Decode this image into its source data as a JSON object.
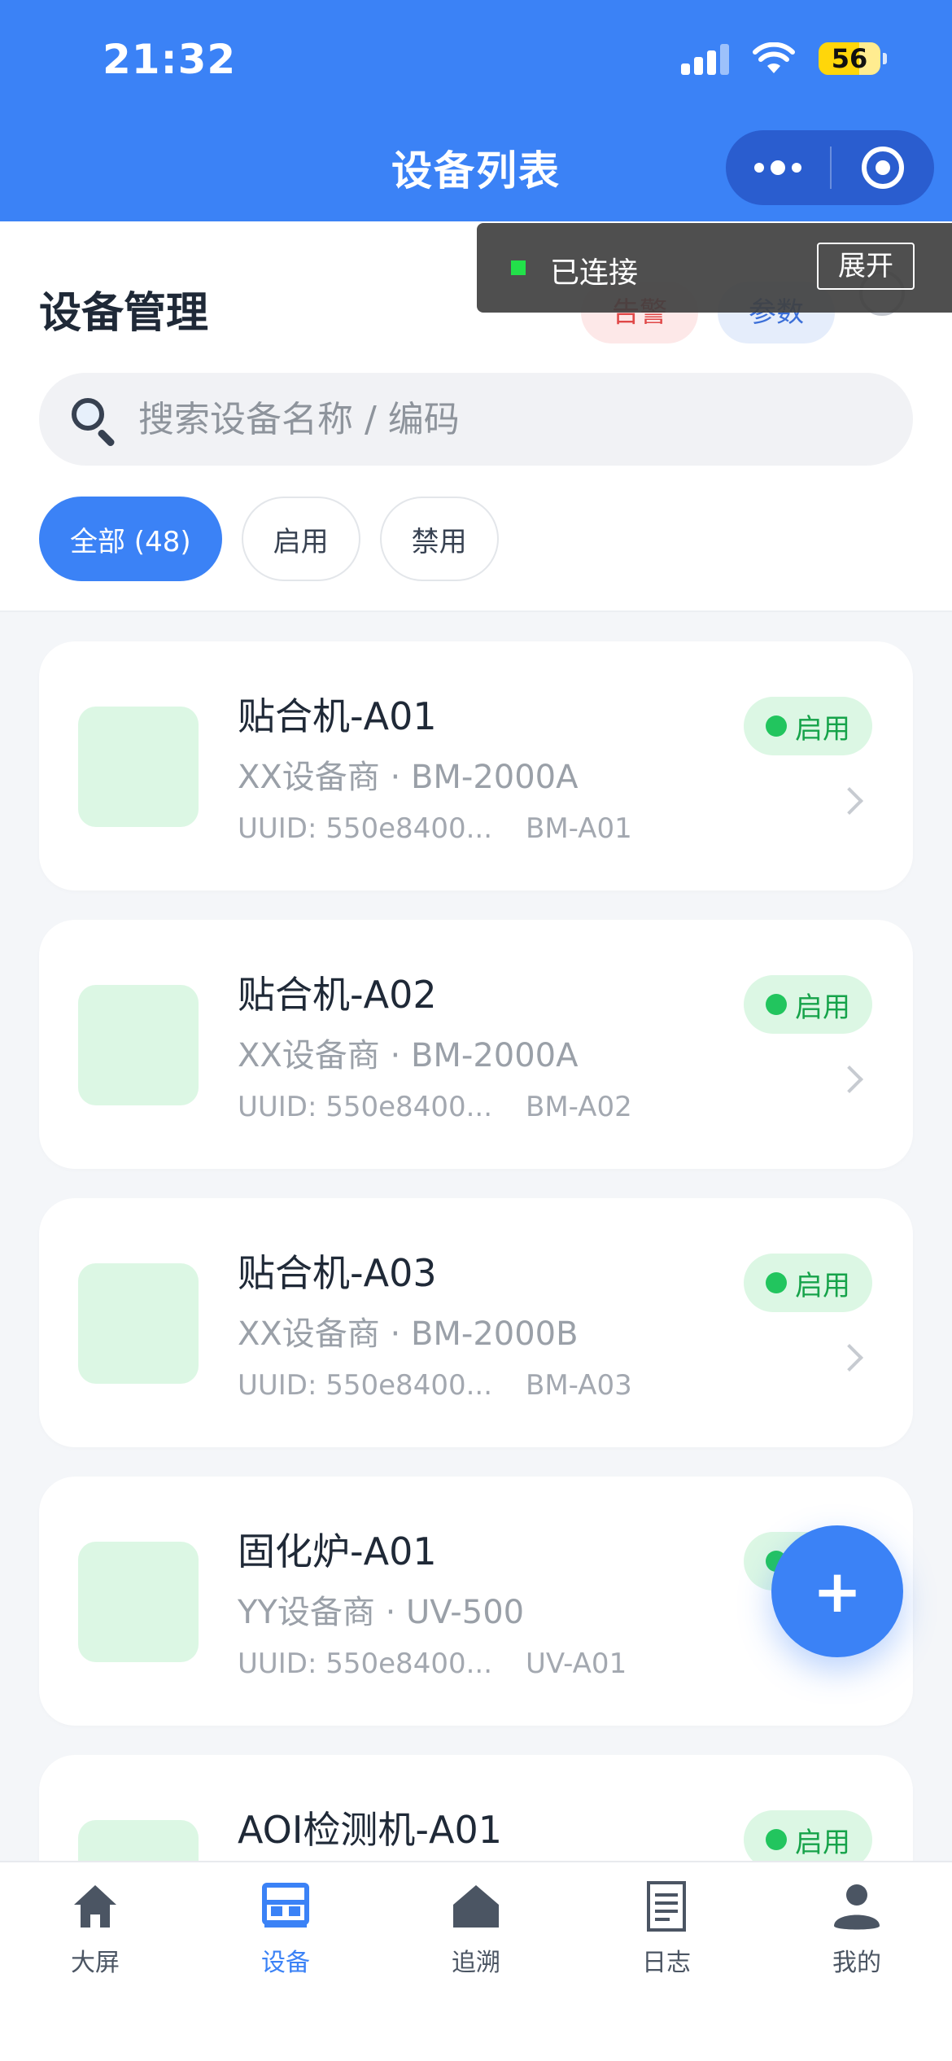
{
  "status_bar": {
    "time": "21:32",
    "battery": "56"
  },
  "nav": {
    "title": "设备列表"
  },
  "header": {
    "title": "设备管理",
    "alarm_label": "告警",
    "param_label": "参数"
  },
  "search": {
    "placeholder": "搜索设备名称 / 编码"
  },
  "filters": [
    {
      "label": "全部 (48)",
      "active": true
    },
    {
      "label": "启用",
      "active": false
    },
    {
      "label": "禁用",
      "active": false
    }
  ],
  "toast": {
    "text": "已连接",
    "button": "展开"
  },
  "devices": [
    {
      "name": "贴合机-A01",
      "vendor": "XX设备商 · BM-2000A",
      "uuid": "UUID: 550e8400...",
      "code": "BM-A01",
      "status": "启用"
    },
    {
      "name": "贴合机-A02",
      "vendor": "XX设备商 · BM-2000A",
      "uuid": "UUID: 550e8400...",
      "code": "BM-A02",
      "status": "启用"
    },
    {
      "name": "贴合机-A03",
      "vendor": "XX设备商 · BM-2000B",
      "uuid": "UUID: 550e8400...",
      "code": "BM-A03",
      "status": "启用"
    },
    {
      "name": "固化炉-A01",
      "vendor": "YY设备商 · UV-500",
      "uuid": "UUID: 550e8400...",
      "code": "UV-A01",
      "status": "启用"
    },
    {
      "name": "AOI检测机-A01",
      "vendor": "",
      "uuid": "",
      "code": "",
      "status": "启用"
    }
  ],
  "fab": {
    "label": "+"
  },
  "tabbar": [
    {
      "label": "大屏",
      "icon": "home-icon",
      "active": false
    },
    {
      "label": "设备",
      "icon": "device-icon",
      "active": true
    },
    {
      "label": "追溯",
      "icon": "trace-icon",
      "active": false
    },
    {
      "label": "日志",
      "icon": "log-icon",
      "active": false
    },
    {
      "label": "我的",
      "icon": "profile-icon",
      "active": false
    }
  ],
  "colors": {
    "primary": "#3b82f6",
    "success": "#22c55e",
    "success_bg": "#dcf7e4",
    "alarm": "#e04848",
    "alarm_bg": "#fde8e8"
  }
}
